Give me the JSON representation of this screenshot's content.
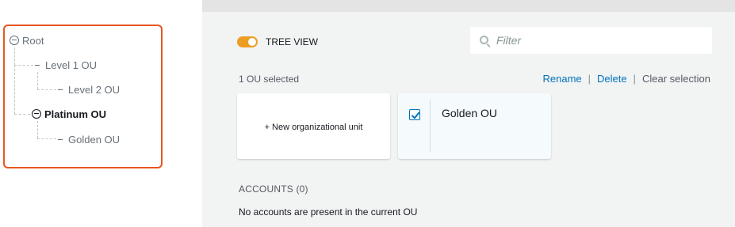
{
  "tree": {
    "root": "Root",
    "level1": "Level 1 OU",
    "level2": "Level 2 OU",
    "platinum": "Platinum OU",
    "golden": "Golden OU"
  },
  "toolbar": {
    "tree_view_label": "TREE VIEW",
    "tree_view_on": true,
    "filter_placeholder": "Filter"
  },
  "selection": {
    "count_text": "1 OU selected",
    "rename": "Rename",
    "delete": "Delete",
    "clear": "Clear selection",
    "separator": "|"
  },
  "cards": {
    "new_label": "+ New organizational unit",
    "ou_name": "Golden OU",
    "ou_checked": true
  },
  "accounts": {
    "title": "ACCOUNTS (0)",
    "empty_text": "No accounts are present in the current OU"
  },
  "colors": {
    "highlight_border": "#e8561f",
    "toggle_on": "#ec9e22",
    "link": "#0073bb"
  }
}
